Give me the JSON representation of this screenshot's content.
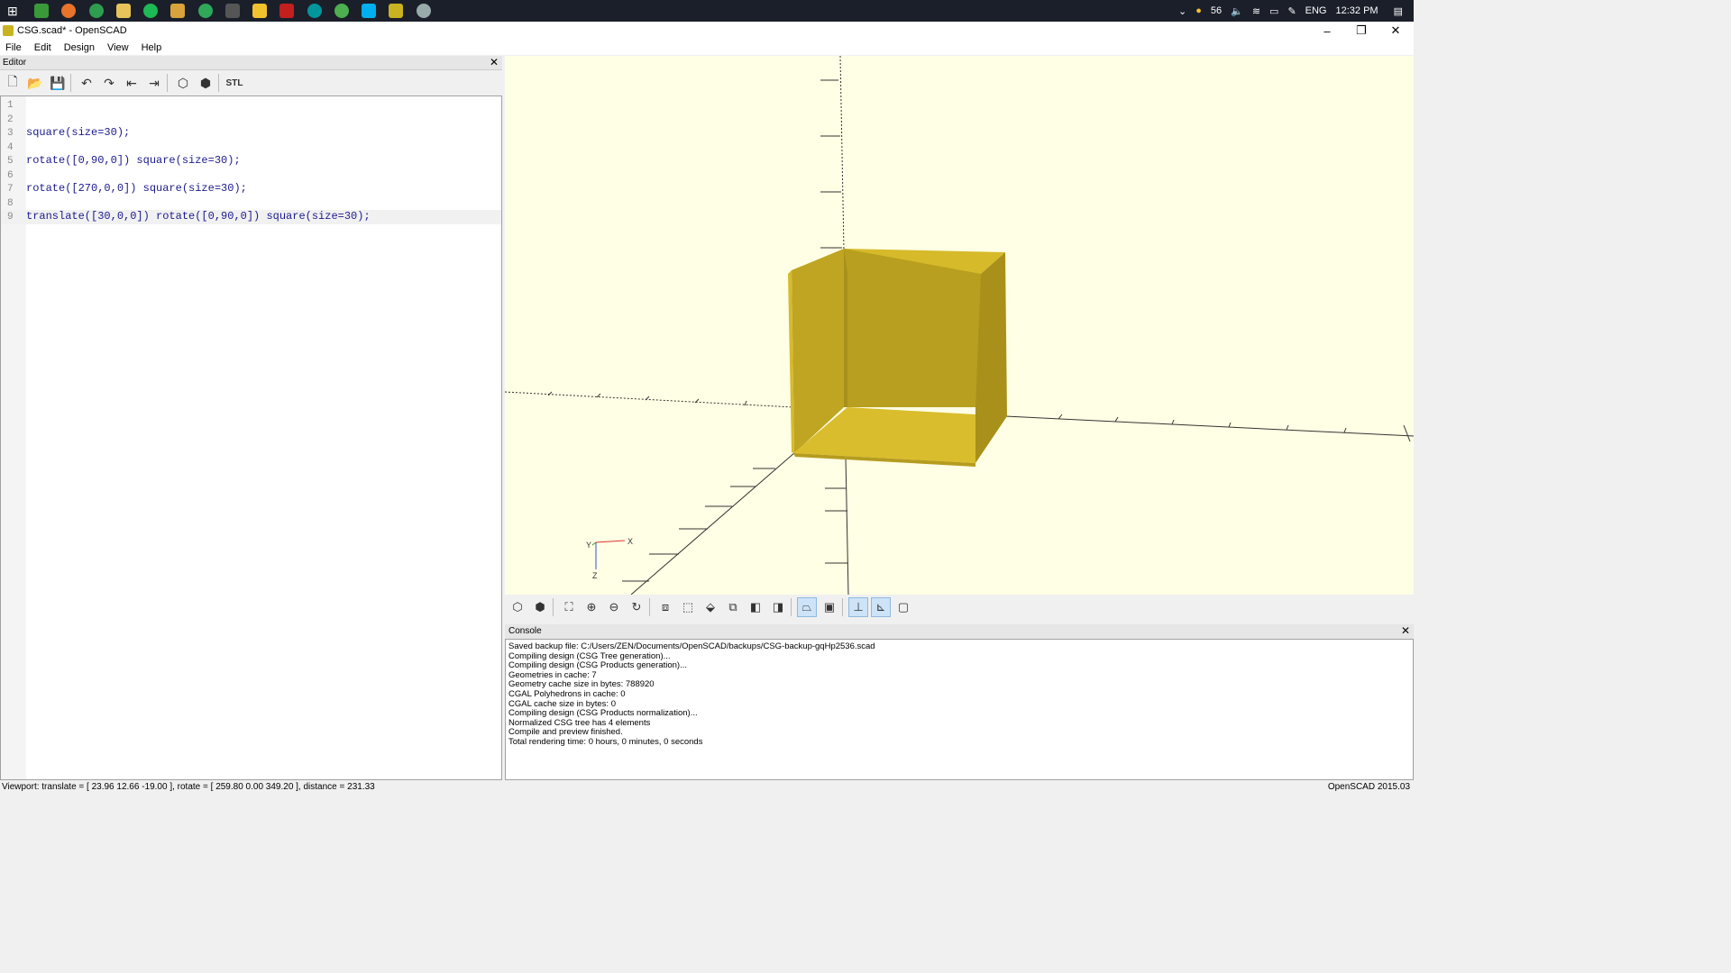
{
  "taskbar": {
    "battery": "56",
    "language": "ENG",
    "time": "12:32 PM"
  },
  "window": {
    "title": "CSG.scad* - OpenSCAD",
    "minimize": "–",
    "maximize": "❐",
    "close": "✕"
  },
  "menu": [
    "File",
    "Edit",
    "Design",
    "View",
    "Help"
  ],
  "editor": {
    "title": "Editor",
    "close": "✕",
    "lines": [
      {
        "n": "1",
        "code": ""
      },
      {
        "n": "2",
        "code": ""
      },
      {
        "n": "3",
        "code": "square(size=30);"
      },
      {
        "n": "4",
        "code": ""
      },
      {
        "n": "5",
        "code": "rotate([0,90,0]) square(size=30);"
      },
      {
        "n": "6",
        "code": ""
      },
      {
        "n": "7",
        "code": "rotate([270,0,0]) square(size=30);"
      },
      {
        "n": "8",
        "code": ""
      },
      {
        "n": "9",
        "code": "translate([30,0,0]) rotate([0,90,0]) square(size=30);"
      }
    ],
    "toolbar_stl": "STL"
  },
  "viewport": {
    "axis_x": "X",
    "axis_y": "Y",
    "axis_z": "Z",
    "colors": {
      "face_light": "#d6ba2a",
      "face_mid": "#bfa521",
      "face_dark": "#a8901b",
      "background": "#ffffe5"
    }
  },
  "console": {
    "title": "Console",
    "close": "✕",
    "lines": [
      "Saved backup file: C:/Users/ZEN/Documents/OpenSCAD/backups/CSG-backup-gqHp2536.scad",
      "Compiling design (CSG Tree generation)...",
      "Compiling design (CSG Products generation)...",
      "Geometries in cache: 7",
      "Geometry cache size in bytes: 788920",
      "CGAL Polyhedrons in cache: 0",
      "CGAL cache size in bytes: 0",
      "Compiling design (CSG Products normalization)...",
      "Normalized CSG tree has 4 elements",
      "Compile and preview finished.",
      "Total rendering time: 0 hours, 0 minutes, 0 seconds"
    ]
  },
  "status": {
    "viewport": "Viewport: translate = [ 23.96 12.66 -19.00 ], rotate = [ 259.80 0.00 349.20 ], distance = 231.33",
    "version": "OpenSCAD 2015.03"
  }
}
